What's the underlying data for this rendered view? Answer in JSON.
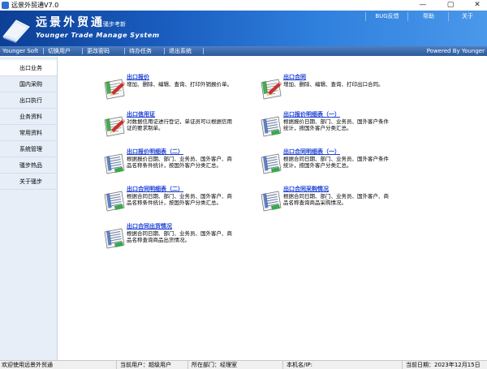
{
  "window": {
    "title": "远景外贸通V7.0",
    "controls": [
      "—",
      "▢",
      "✕"
    ]
  },
  "banner": {
    "brand_cn": "远景外贸通",
    "brand_tag": "骚步考新",
    "brand_en": "Younger Trade Manage System",
    "links": [
      "BUG反馈",
      "帮助",
      "关于"
    ]
  },
  "toolbar": {
    "items": [
      "Younger Soft",
      "切换用户",
      "更改密码",
      "待办任务",
      "退出系统"
    ],
    "powered": "Powered By Younger"
  },
  "sidebar": {
    "items": [
      "出口业务",
      "国内采购",
      "出口执行",
      "业务资料",
      "常用资料",
      "系统管理",
      "骚步热品",
      "关于骚步"
    ],
    "active": 0
  },
  "tiles": [
    {
      "title": "出口报价",
      "desc": "增加、删除、编辑、查询、打印外销报价单。",
      "icon": "report-pencil-icon"
    },
    {
      "title": "出口合同",
      "desc": "增加、删除、编辑、查询、打印出口合同。",
      "icon": "report-pencil-icon"
    },
    {
      "title": "出口信用证",
      "desc": "对数据信用证进行登记，单证员可以根据信用证的要求制单。",
      "icon": "report-pencil-icon"
    },
    {
      "title": "出口报价明细表（一）",
      "desc": "根据报价日期、部门、业务员、国外客户条件统计，按国外客户分类汇总。",
      "icon": "report-list-icon"
    },
    {
      "title": "出口报价明细表（二）",
      "desc": "根据报价日期、部门、业务员、国外客户、商品名称条件统计，按国外客户分类汇总。",
      "icon": "report-list-icon"
    },
    {
      "title": "出口合同明细表（一）",
      "desc": "根据合同日期、部门、业务员、国外客户条件统计，按国外客户分类汇总。",
      "icon": "report-list-icon"
    },
    {
      "title": "出口合同明细表（二）",
      "desc": "根据合同日期、部门、业务员、国外客户、商品名称条件统计，按国外客户分类汇总。",
      "icon": "report-list-icon"
    },
    {
      "title": "出口合同采购情况",
      "desc": "根据合同日期、部门、业务员、国外客户、商品名称查询商品采购情况。",
      "icon": "report-list-icon"
    },
    {
      "title": "出口合同出货情况",
      "desc": "根据合同日期、部门、业务员、国外客户、商品名称查询商品出货情况。",
      "icon": "report-list-icon"
    }
  ],
  "status": {
    "welcome": "欢迎使用远景外贸通",
    "user": "当前用户：超级用户",
    "dept": "所在部门：经理室",
    "host": "本机名/IP:",
    "date": "当前日期：2023年12月15日"
  }
}
